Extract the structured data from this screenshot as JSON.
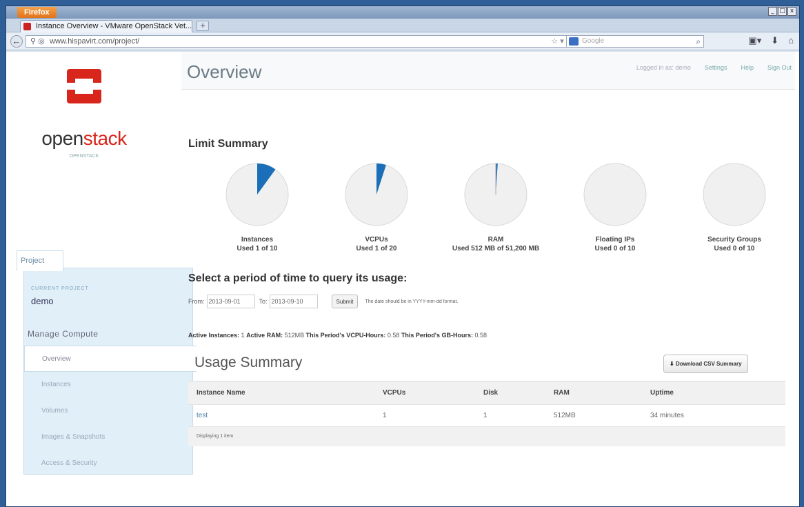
{
  "browser": {
    "menu_button": "Firefox",
    "tab_title": "Instance Overview - VMware OpenStack Vet...",
    "new_tab": "+",
    "url": "www.hispavirt.com/project/",
    "search_placeholder": "Google",
    "window_controls": [
      "_",
      "□",
      "x"
    ]
  },
  "brand": {
    "name_part1": "open",
    "name_part2": "stack",
    "tagline": "OPENSTACK",
    "color": "#d9261c"
  },
  "sidebar": {
    "tab": "Project",
    "current_project_label": "CURRENT PROJECT",
    "current_project": "demo",
    "section": "Manage Compute",
    "items": [
      {
        "label": "Overview"
      },
      {
        "label": "Instances"
      },
      {
        "label": "Volumes"
      },
      {
        "label": "Images & Snapshots"
      },
      {
        "label": "Access & Security"
      }
    ]
  },
  "header": {
    "title": "Overview",
    "logged_in": "Logged in as: demo",
    "settings": "Settings",
    "help": "Help",
    "sign_out": "Sign Out"
  },
  "limits": {
    "title": "Limit Summary",
    "pie_color": "#1a6fb8",
    "items": [
      {
        "name": "Instances",
        "used_text": "Used 1 of 10",
        "used": 1,
        "total": 10
      },
      {
        "name": "VCPUs",
        "used_text": "Used 1 of 20",
        "used": 1,
        "total": 20
      },
      {
        "name": "RAM",
        "used_text": "Used 512 MB of 51,200 MB",
        "used": 512,
        "total": 51200
      },
      {
        "name": "Floating IPs",
        "used_text": "Used 0 of 10",
        "used": 0,
        "total": 10
      },
      {
        "name": "Security Groups",
        "used_text": "Used 0 of 10",
        "used": 0,
        "total": 10
      }
    ]
  },
  "query": {
    "title": "Select a period of time to query its usage:",
    "from_label": "From:",
    "from_value": "2013-09-01",
    "to_label": "To:",
    "to_value": "2013-09-10",
    "submit": "Submit",
    "hint": "The date should be in YYYY-mm-dd format."
  },
  "stats": {
    "active_instances_label": "Active Instances:",
    "active_instances": "1",
    "active_ram_label": "Active RAM:",
    "active_ram": "512MB",
    "vcpu_hours_label": "This Period's VCPU-Hours:",
    "vcpu_hours": "0.58",
    "gb_hours_label": "This Period's GB-Hours:",
    "gb_hours": "0.58"
  },
  "usage": {
    "title": "Usage Summary",
    "csv_button": "Download CSV Summary",
    "columns": [
      "Instance Name",
      "VCPUs",
      "Disk",
      "RAM",
      "Uptime"
    ],
    "rows": [
      [
        "test",
        "1",
        "1",
        "512MB",
        "34 minutes"
      ]
    ],
    "footer": "Displaying 1 item"
  }
}
